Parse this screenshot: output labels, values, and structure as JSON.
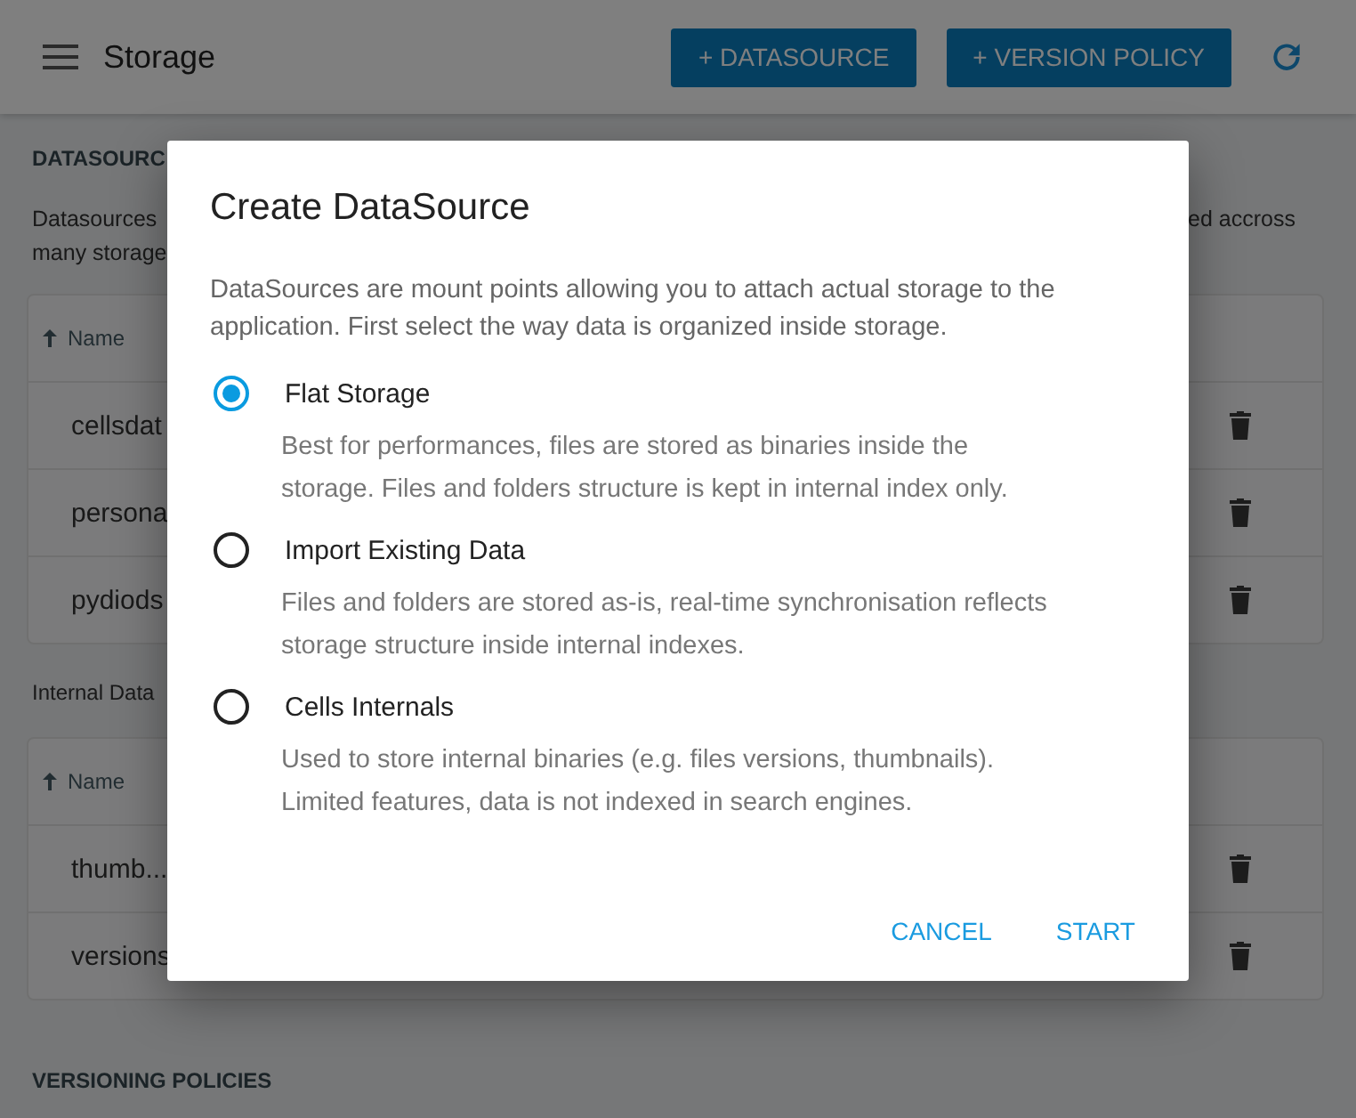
{
  "app_bar": {
    "title": "Storage",
    "buttons": [
      "+ DATASOURCE",
      "+ VERSION POLICY"
    ]
  },
  "datasources": {
    "heading": "DATASOURC",
    "description_left": [
      "Datasources",
      "many storage"
    ],
    "description_right": "ed accross",
    "table": {
      "sort_column": "Name",
      "rows": [
        "cellsdat",
        "persona",
        "pydiods"
      ]
    }
  },
  "internal": {
    "heading": "Internal Data",
    "table": {
      "sort_column": "Name",
      "rows": [
        "thumb...",
        "versions"
      ]
    }
  },
  "versioning_heading": "VERSIONING POLICIES",
  "dialog": {
    "title": "Create DataSource",
    "intro": "DataSources are mount points allowing you to attach actual storage to the application. First select the way data is organized inside storage.",
    "options": [
      {
        "label": "Flat Storage",
        "description": "Best for performances, files are stored as binaries inside the storage. Files and folders structure is kept in internal index only.",
        "selected": true
      },
      {
        "label": "Import Existing Data",
        "description": "Files and folders are stored as-is, real-time synchronisation reflects storage structure inside internal indexes.",
        "selected": false
      },
      {
        "label": "Cells Internals",
        "description": "Used to store internal binaries (e.g. files versions, thumbnails). Limited features, data is not indexed in search engines.",
        "selected": false
      }
    ],
    "buttons": [
      "CANCEL",
      "START"
    ]
  }
}
